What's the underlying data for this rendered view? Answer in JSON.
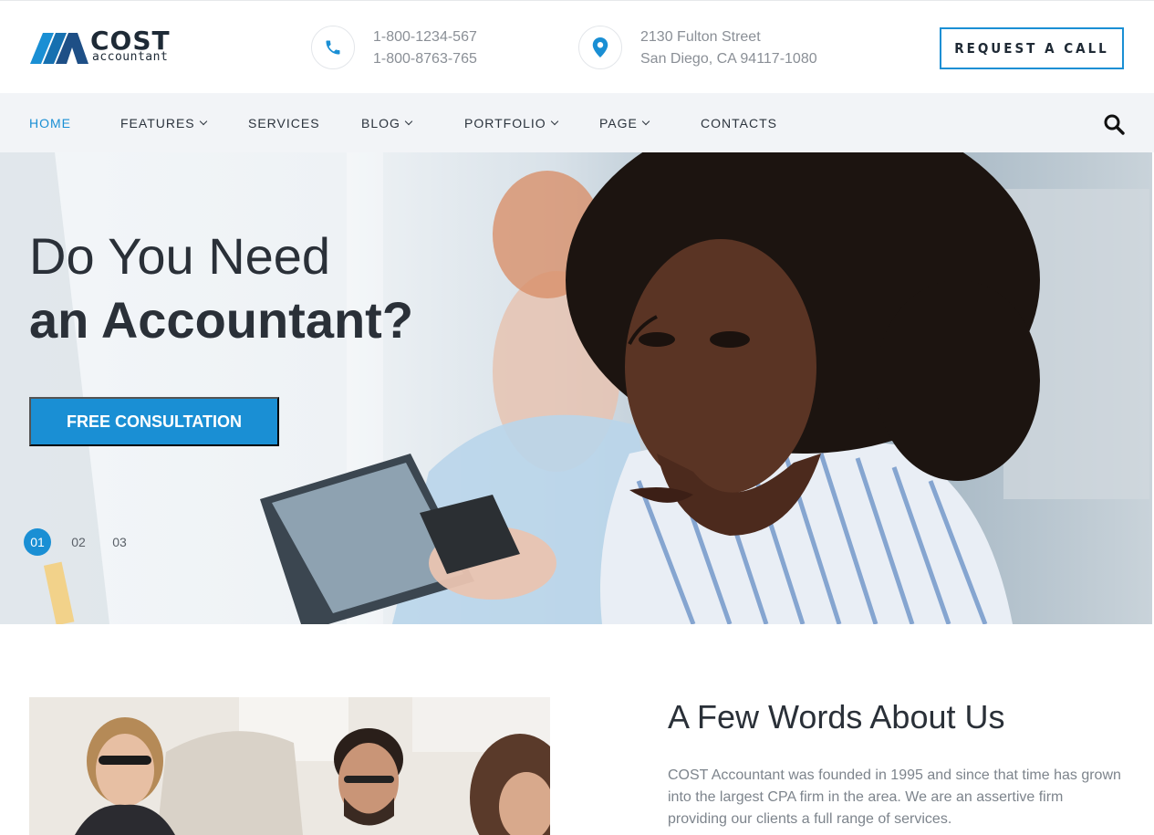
{
  "brand": {
    "name": "COST",
    "tagline": "accountant",
    "accent_color": "#1a8fd4",
    "dark_color": "#2a3038"
  },
  "header": {
    "phones": [
      "1-800-1234-567",
      "1-800-8763-765"
    ],
    "address": [
      "2130 Fulton Street",
      "San Diego, CA 94117-1080"
    ],
    "phone_icon": "phone-icon",
    "address_icon": "map-pin-icon",
    "request_button": "REQUEST A CALL"
  },
  "nav": {
    "items": [
      {
        "label": "HOME",
        "active": true,
        "dropdown": false
      },
      {
        "label": "FEATURES",
        "active": false,
        "dropdown": true
      },
      {
        "label": "SERVICES",
        "active": false,
        "dropdown": false
      },
      {
        "label": "BLOG",
        "active": false,
        "dropdown": true
      },
      {
        "label": "PORTFOLIO",
        "active": false,
        "dropdown": true
      },
      {
        "label": "PAGE",
        "active": false,
        "dropdown": true
      },
      {
        "label": "CONTACTS",
        "active": false,
        "dropdown": false
      }
    ],
    "search_icon": "search-icon"
  },
  "hero": {
    "title_line1": "Do You Need",
    "title_line2": "an Accountant?",
    "cta": "FREE CONSULTATION",
    "slides": [
      "01",
      "02",
      "03"
    ],
    "active_slide": "01"
  },
  "about": {
    "title": "A Few Words About Us",
    "text": "COST Accountant was founded in 1995 and since that time has grown into the largest CPA firm in the area. We are an assertive firm providing our clients a full range of services."
  }
}
